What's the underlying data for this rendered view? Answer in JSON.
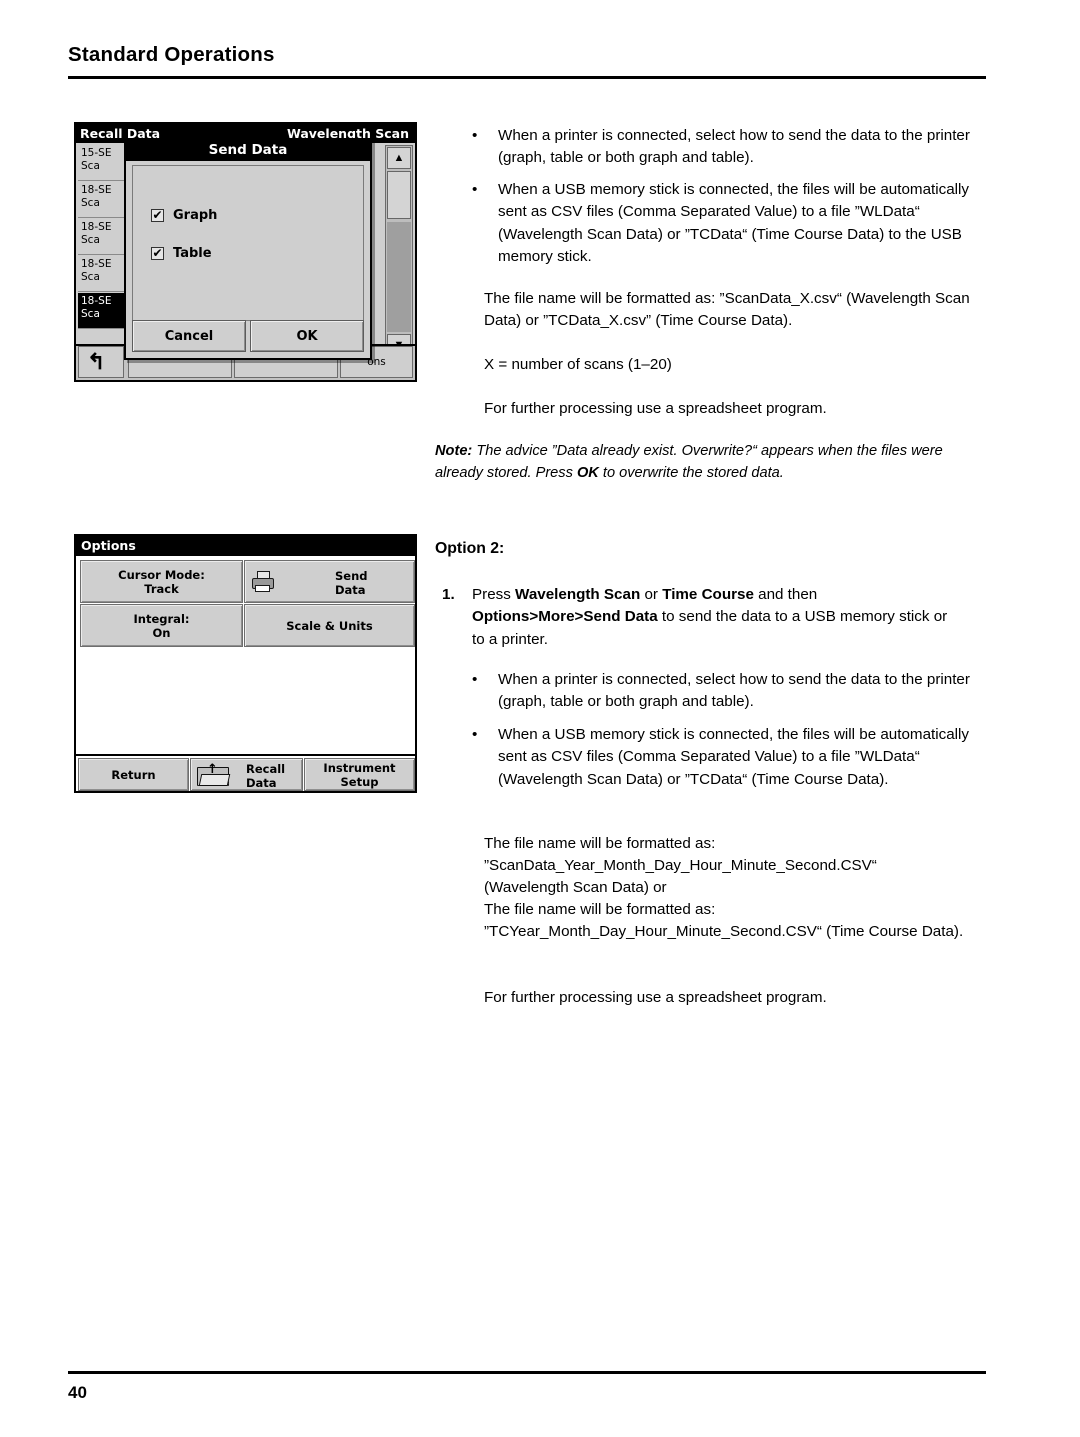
{
  "header": {
    "title": "Standard Operations"
  },
  "footer": {
    "page_number": "40"
  },
  "screenshot_recall": {
    "window_title": "Recall Data",
    "window_title_right": "Wavelength Scan",
    "list_rows": [
      {
        "line1": "15-SE",
        "line2": "Sca"
      },
      {
        "line1": "18-SE",
        "line2": "Sca"
      },
      {
        "line1": "18-SE",
        "line2": "Sca"
      },
      {
        "line1": "18-SE",
        "line2": "Sca"
      },
      {
        "line1": "18-SE",
        "line2": "Sca"
      }
    ],
    "scroll_up": "▲",
    "scroll_down": "▼",
    "back_icon": "back-arrow",
    "bottom_right_label": "ons",
    "dialog": {
      "title": "Send Data",
      "checkbox_graph": {
        "label": "Graph",
        "checked": true,
        "mark": "✔"
      },
      "checkbox_table": {
        "label": "Table",
        "checked": true,
        "mark": "✔"
      },
      "cancel": "Cancel",
      "ok": "OK"
    }
  },
  "screenshot_options": {
    "window_title": "Options",
    "buttons": [
      {
        "line1": "Cursor Mode:",
        "line2": "Track"
      },
      {
        "line1": "Send",
        "line2": "Data"
      },
      {
        "line1": "Integral:",
        "line2": "On"
      },
      {
        "line1": "Scale & Units",
        "line2": ""
      },
      {
        "line1": "Return",
        "line2": ""
      },
      {
        "line1": "Recall",
        "line2": "Data"
      },
      {
        "line1": "Instrument",
        "line2": "Setup"
      }
    ],
    "icons": {
      "printer": "printer-icon",
      "folder": "folder-open-icon"
    }
  },
  "content": {
    "bullet": "•",
    "option1": {
      "bullet1": "When a printer is connected, select how to send the data to the printer (graph, table or both graph and table).",
      "bullet2": "When a USB memory stick is connected, the files will be automatically sent as CSV files (Comma Separated Value) to a file ”WLData“ (Wavelength Scan Data) or ”TCData“ (Time Course Data) to the USB memory stick.",
      "para1": "The file name will be formatted as: ”ScanData_X.csv“ (Wavelength Scan Data) or ”TCData_X.csv” (Time Course Data).",
      "para2": "X = number of scans (1–20)",
      "para3": "For further processing use a spreadsheet program.",
      "note_prefix": "Note:",
      "note_part1": " The advice ”Data already exist. Overwrite?“ appears when the files were already stored. Press ",
      "note_bold": "OK",
      "note_part2": " to overwrite the stored data."
    },
    "option2": {
      "heading": "Option 2:",
      "step_number": "1.",
      "step_text_1": "Press ",
      "step_bold_1": "Wavelength Scan",
      "step_text_2": " or ",
      "step_bold_2": "Time Course",
      "step_text_3": " and then ",
      "step_bold_3": "Options>More>Send Data",
      "step_text_4": " to send the data to a USB memory stick or to a printer.",
      "bullet1": "When a printer is connected, select how to send the data to the printer (graph, table or both graph and table).",
      "bullet2": "When a USB memory stick is connected, the files will be automatically sent as CSV files (Comma Separated Value) to a file ”WLData“ (Wavelength Scan Data) or ”TCData“ (Time Course Data).",
      "para1_line1": "The file name will be formatted as:",
      "para1_line2": "”ScanData_Year_Month_Day_Hour_Minute_Second.CSV“",
      "para1_line3": "(Wavelength Scan Data) or",
      "para2_line1": "The file name will be formatted as:",
      "para2_line2": "”TCYear_Month_Day_Hour_Minute_Second.CSV“ (Time Course Data).",
      "para3": "For further processing use a spreadsheet program."
    }
  }
}
